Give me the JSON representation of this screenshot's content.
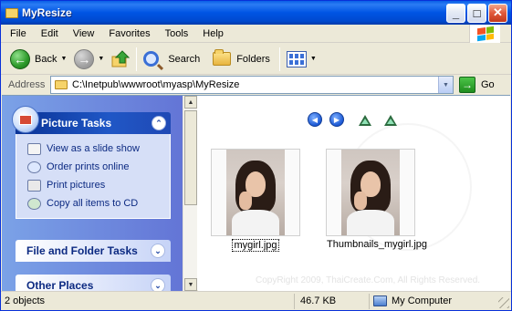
{
  "window": {
    "title": "MyResize",
    "controls": {
      "minimize": "_",
      "maximize": "□",
      "close": "✕"
    }
  },
  "menu": {
    "items": [
      "File",
      "Edit",
      "View",
      "Favorites",
      "Tools",
      "Help"
    ],
    "logo_icon": "windows-flag-icon"
  },
  "toolbar": {
    "back_label": "Back",
    "search_label": "Search",
    "folders_label": "Folders"
  },
  "address": {
    "label": "Address",
    "value": "C:\\Inetpub\\wwwroot\\myasp\\MyResize",
    "go_label": "Go"
  },
  "tasks": {
    "picture_tasks": {
      "title": "Picture Tasks",
      "items": [
        {
          "label": "View as a slide show",
          "icon": "slideshow-icon"
        },
        {
          "label": "Order prints online",
          "icon": "order-prints-icon"
        },
        {
          "label": "Print pictures",
          "icon": "printer-icon"
        },
        {
          "label": "Copy all items to CD",
          "icon": "cd-icon"
        }
      ]
    },
    "file_folder_tasks": {
      "title": "File and Folder Tasks"
    },
    "other_places": {
      "title": "Other Places"
    }
  },
  "files": [
    {
      "name": "mygirl.jpg",
      "focused": true
    },
    {
      "name": "Thumbnails_mygirl.jpg",
      "focused": false
    }
  ],
  "watermark": "CopyRight 2009, ThaiCreate.Com, All Rights Reserved.",
  "status": {
    "objects": "2 objects",
    "size": "46.7 KB",
    "location": "My Computer"
  },
  "colors": {
    "titlebar": "#0054e3",
    "taskpane": "#6375d6",
    "panel_header": "#0a3396",
    "link": "#0c2a82"
  }
}
